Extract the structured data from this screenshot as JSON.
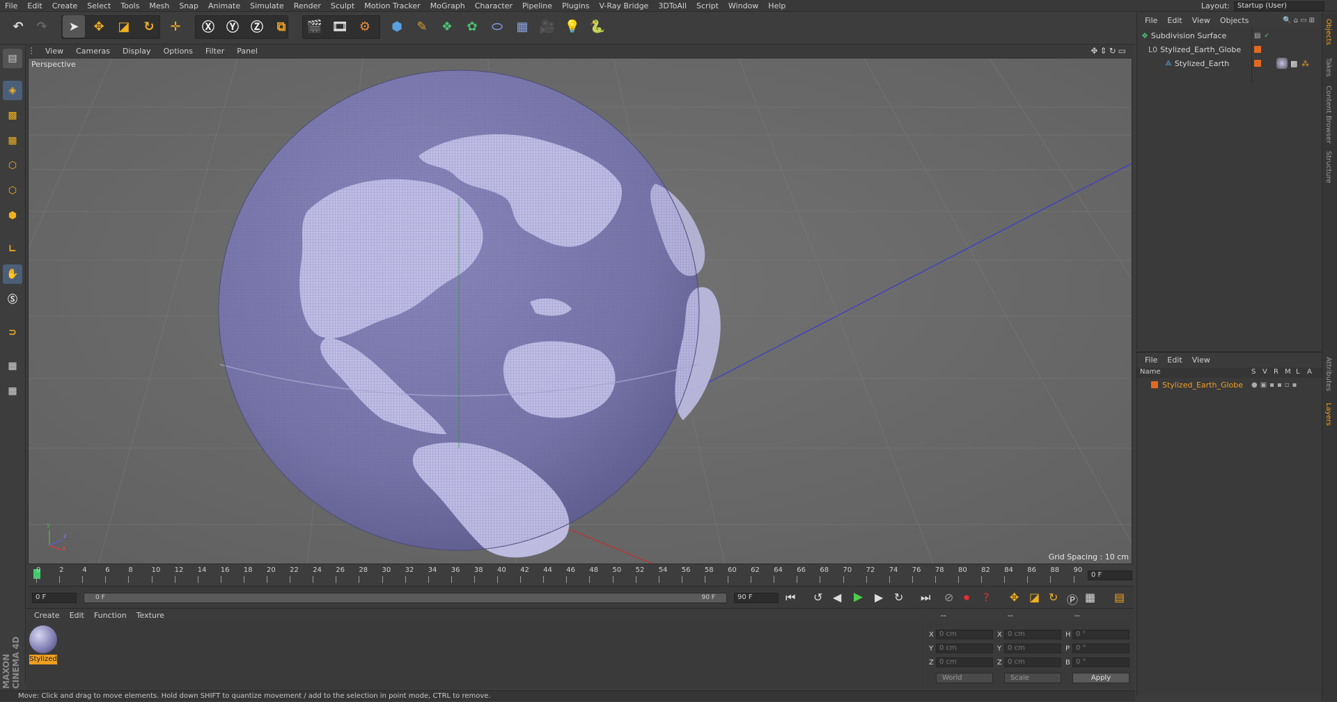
{
  "menubar": {
    "items": [
      "File",
      "Edit",
      "Create",
      "Select",
      "Tools",
      "Mesh",
      "Snap",
      "Animate",
      "Simulate",
      "Render",
      "Sculpt",
      "Motion Tracker",
      "MoGraph",
      "Character",
      "Pipeline",
      "Plugins",
      "V-Ray Bridge",
      "3DToAll",
      "Script",
      "Window",
      "Help"
    ],
    "layout_label": "Layout:",
    "layout_value": "Startup (User)"
  },
  "viewport": {
    "menu": [
      "View",
      "Cameras",
      "Display",
      "Options",
      "Filter",
      "Panel"
    ],
    "label": "Perspective",
    "grid_spacing": "Grid Spacing : 10 cm",
    "axis_x": "x",
    "axis_y": "y",
    "axis_z": "z"
  },
  "timeline": {
    "ticks": [
      "0",
      "2",
      "4",
      "6",
      "8",
      "10",
      "12",
      "14",
      "16",
      "18",
      "20",
      "22",
      "24",
      "26",
      "28",
      "30",
      "32",
      "34",
      "36",
      "38",
      "40",
      "42",
      "44",
      "46",
      "48",
      "50",
      "52",
      "54",
      "56",
      "58",
      "60",
      "62",
      "64",
      "66",
      "68",
      "70",
      "72",
      "74",
      "76",
      "78",
      "80",
      "82",
      "84",
      "86",
      "88",
      "90"
    ],
    "current_frame_box": "0 F"
  },
  "transport": {
    "start_field": "0 F",
    "range_start": "0 F",
    "range_end": "90 F",
    "end_field": "90 F"
  },
  "material_panel": {
    "menu": [
      "Create",
      "Edit",
      "Function",
      "Texture"
    ],
    "material_name": "Stylized"
  },
  "coord_panel": {
    "headers": [
      "--",
      "--",
      "--"
    ],
    "rows": [
      {
        "l1": "X",
        "v1": "0 cm",
        "l2": "X",
        "v2": "0 cm",
        "l3": "H",
        "v3": "0 °"
      },
      {
        "l1": "Y",
        "v1": "0 cm",
        "l2": "Y",
        "v2": "0 cm",
        "l3": "P",
        "v3": "0 °"
      },
      {
        "l1": "Z",
        "v1": "0 cm",
        "l2": "Z",
        "v2": "0 cm",
        "l3": "B",
        "v3": "0 °"
      }
    ],
    "world": "World",
    "scale": "Scale",
    "apply": "Apply"
  },
  "status": "Move: Click and drag to move elements. Hold down SHIFT to quantize movement / add to the selection in point mode, CTRL to remove.",
  "object_manager": {
    "menu": [
      "File",
      "Edit",
      "View",
      "Objects"
    ],
    "objects": [
      "Subdivision Surface",
      "Stylized_Earth_Globe",
      "Stylized_Earth"
    ]
  },
  "layer_manager": {
    "menu": [
      "File",
      "Edit",
      "View"
    ],
    "columns": [
      "Name",
      "S",
      "V",
      "R",
      "M",
      "L",
      "A"
    ],
    "layer": "Stylized_Earth_Globe"
  },
  "right_tabs": [
    "Objects",
    "Takes",
    "Content Browser",
    "Structure",
    "Attributes",
    "Layers"
  ],
  "brand": "MAXON CINEMA 4D",
  "colors": {
    "accent": "#f0a020",
    "globe": "#7d7ab0",
    "land": "#c4c2ea"
  }
}
